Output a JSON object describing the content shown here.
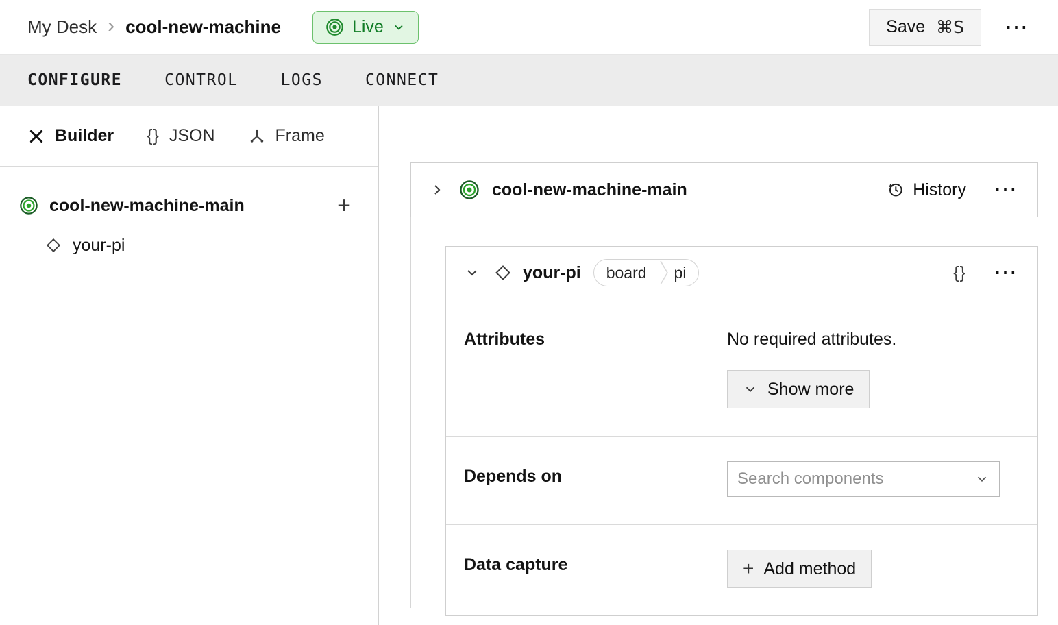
{
  "header": {
    "breadcrumb": {
      "parent": "My Desk",
      "separator": "›",
      "current": "cool-new-machine"
    },
    "live": {
      "label": "Live"
    },
    "save": {
      "label": "Save",
      "shortcut": "⌘S"
    },
    "overflow": "⋯"
  },
  "tabs": [
    {
      "label": "CONFIGURE",
      "active": true
    },
    {
      "label": "CONTROL",
      "active": false
    },
    {
      "label": "LOGS",
      "active": false
    },
    {
      "label": "CONNECT",
      "active": false
    }
  ],
  "sidebar": {
    "modes": [
      {
        "label": "Builder"
      },
      {
        "label": "JSON"
      },
      {
        "label": "Frame"
      }
    ],
    "braces_glyph": "{}",
    "tree": {
      "root": "cool-new-machine-main",
      "child": "your-pi",
      "add": "+"
    }
  },
  "main": {
    "machine_card": {
      "title": "cool-new-machine-main",
      "history": "History",
      "overflow": "⋯"
    },
    "component_card": {
      "title": "your-pi",
      "tags": [
        "board",
        "pi"
      ],
      "braces_glyph": "{}",
      "overflow": "⋯",
      "attributes": {
        "label": "Attributes",
        "empty": "No required attributes.",
        "show_more": "Show more"
      },
      "depends": {
        "label": "Depends on",
        "placeholder": "Search components"
      },
      "capture": {
        "label": "Data capture",
        "add_glyph": "+",
        "add": "Add method"
      }
    }
  },
  "colors": {
    "accent_green": "#2ba32b",
    "accent_green_dark": "#1b5e26",
    "live_bg": "#e2f6e3",
    "live_border": "#6cc16d",
    "live_text": "#127d27"
  }
}
